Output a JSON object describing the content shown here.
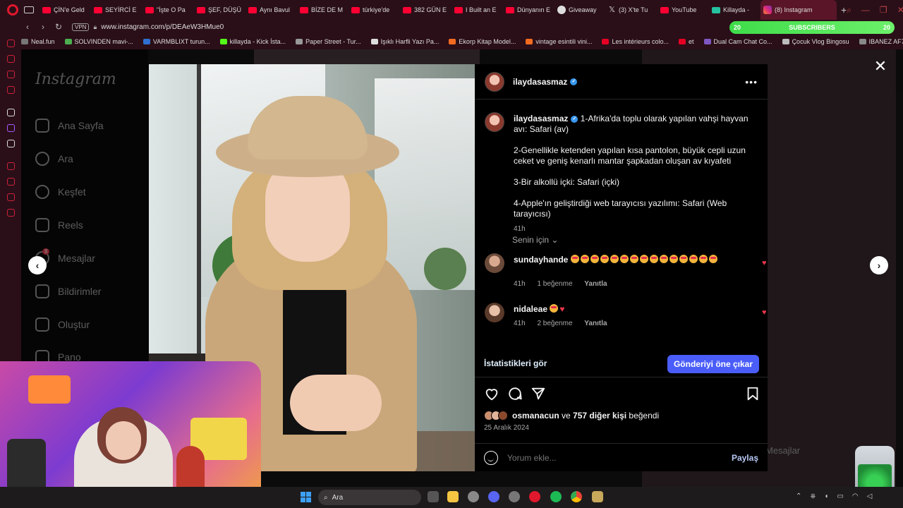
{
  "browser": {
    "tabs": [
      {
        "label": "ÇİN'e Geld",
        "fav": "youtube-icon"
      },
      {
        "label": "SEYİRCİ E",
        "fav": "youtube-icon"
      },
      {
        "label": "\"İşte O Pa",
        "fav": "youtube-icon"
      },
      {
        "label": "ŞEF, DÜŞÜ",
        "fav": "youtube-icon"
      },
      {
        "label": "Aynı Bavul",
        "fav": "youtube-icon"
      },
      {
        "label": "BİZE DE M",
        "fav": "youtube-icon"
      },
      {
        "label": "türkiye'de",
        "fav": "youtube-icon"
      },
      {
        "label": "382 GÜN E",
        "fav": "youtube-icon"
      },
      {
        "label": "I Built an E",
        "fav": "youtube-icon"
      },
      {
        "label": "Dünyanın E",
        "fav": "youtube-icon"
      },
      {
        "label": "Giveaway",
        "fav": "giveaway-icon"
      },
      {
        "label": "(3) X'te Tu",
        "fav": "x-icon"
      },
      {
        "label": "YouTube",
        "fav": "youtube-icon"
      },
      {
        "label": "Killayda -",
        "fav": "twitch-icon"
      }
    ],
    "active_tab": "(8) Instagram",
    "url": "www.instagram.com/p/DEAeW3HMue0",
    "vpn": "VPN",
    "subs_widget": {
      "left": "20",
      "label": "SUBSCRIBERS",
      "right": "20"
    },
    "bookmarks": [
      {
        "label": "Neal.fun",
        "color": "#777777"
      },
      {
        "label": "SOLVINDEN mavi-...",
        "color": "#4caf50"
      },
      {
        "label": "VARMBLIXT turun...",
        "color": "#2f6fd1"
      },
      {
        "label": "killayda - Kick İsta...",
        "color": "#53fc18"
      },
      {
        "label": "Paper Street - Tur...",
        "color": "#999999"
      },
      {
        "label": "Işıklı Harfli Yazı Pa...",
        "color": "#dddddd"
      },
      {
        "label": "Ekorp Kitap Model...",
        "color": "#f26b21"
      },
      {
        "label": "vintage esintili vini...",
        "color": "#f26b21"
      },
      {
        "label": "Les intérieurs colo...",
        "color": "#e60023"
      },
      {
        "label": "et",
        "color": "#e60023"
      },
      {
        "label": "Dual Cam Chat Co...",
        "color": "#7e57c2"
      },
      {
        "label": "Çocuk Vlog Bingosu",
        "color": "#bbbbbb"
      },
      {
        "label": "IBANEZ AF75G-B...",
        "color": "#888888"
      }
    ]
  },
  "instagram": {
    "logo": "Instagram",
    "nav": [
      {
        "label": "Ana Sayfa",
        "icon": "home-icon"
      },
      {
        "label": "Ara",
        "icon": "search-icon"
      },
      {
        "label": "Keşfet",
        "icon": "compass-icon"
      },
      {
        "label": "Reels",
        "icon": "reels-icon"
      },
      {
        "label": "Mesajlar",
        "icon": "messenger-icon",
        "badge": "8"
      },
      {
        "label": "Bildirimler",
        "icon": "heart-icon"
      },
      {
        "label": "Oluştur",
        "icon": "plus-square-icon"
      },
      {
        "label": "Pano",
        "icon": "dashboard-icon"
      }
    ],
    "ghost_messages": "Mesajlar"
  },
  "post": {
    "username": "ilaydasasmaz",
    "caption": {
      "lines": [
        "1-Afrika'da toplu olarak yapılan vahşi hayvan avı: Safari (av)",
        "2-Genellikle ketenden yapılan kısa pantolon, büyük cepli uzun ceket ve geniş kenarlı mantar şapkadan oluşan av kıyafeti",
        "3-Bir alkollü içki: Safari (içki)",
        "4-Apple'ın geliştirdiği web tarayıcısı yazılımı: Safari (Web tarayıcısı)"
      ],
      "time": "41h"
    },
    "filter": "Senin için",
    "comments": [
      {
        "user": "sundayhande",
        "emoji_count": 15,
        "time": "41h",
        "likes": "1 beğenme",
        "reply": "Yanıtla"
      },
      {
        "user": "nidaleae",
        "emoji_count": 0,
        "time": "41h",
        "likes": "2 beğenme",
        "reply": "Yanıtla"
      }
    ],
    "insights": "İstatistikleri gör",
    "boost": "Gönderiyi öne çıkar",
    "liked_by": {
      "user": "osmanacun",
      "middle": " ve ",
      "others": "757 diğer kişi",
      "suffix": " beğendi"
    },
    "date": "25 Aralık 2024",
    "comment_placeholder": "Yorum ekle...",
    "post_button": "Paylaş"
  },
  "taskbar": {
    "search": "Ara"
  },
  "colors": {
    "accent": "#4a5df9",
    "heart": "#e8354a",
    "verified": "#3897f0",
    "browser_bg": "#2a0f18"
  }
}
